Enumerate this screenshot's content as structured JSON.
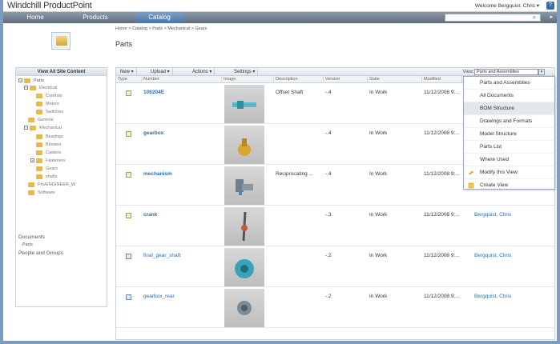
{
  "app": {
    "brand": "Windchill ProductPoint",
    "welcome": "Welcome Bergquist, Chris ▾",
    "help_icon": "?"
  },
  "nav": {
    "tabs": [
      {
        "label": "Home"
      },
      {
        "label": "Products"
      },
      {
        "label": "Catalog"
      }
    ],
    "search_placeholder": "",
    "search_icon": "⌕"
  },
  "breadcrumb": "Home > Catalog > Parts > Mechanical > Gears",
  "page_title": "Parts",
  "leftnav": {
    "header": "View All Site Content",
    "tree": [
      {
        "label": "Parts"
      },
      {
        "label": "Electrical"
      },
      {
        "label": "Controls"
      },
      {
        "label": "Motors"
      },
      {
        "label": "Switches"
      },
      {
        "label": "General"
      },
      {
        "label": "Mechanical"
      },
      {
        "label": "Bearings"
      },
      {
        "label": "Blowers"
      },
      {
        "label": "Casters"
      },
      {
        "label": "Fasteners"
      },
      {
        "label": "Gears"
      },
      {
        "label": "shafts"
      },
      {
        "label": "Pro/ENGINEER_W"
      },
      {
        "label": "Software"
      }
    ],
    "links": [
      "Documents",
      "Parts",
      "People and Groups"
    ]
  },
  "toolbar": {
    "new": "New ▾",
    "upload": "Upload ▾",
    "actions": "Actions ▾",
    "settings": "Settings ▾",
    "view_label": "View:",
    "view_value": "Parts and Assemblies",
    "view_btn": "▾"
  },
  "columns": [
    "Type",
    "Number",
    "Image",
    "Description",
    "Version",
    "State",
    "Modified"
  ],
  "rows": [
    {
      "number": "106204E",
      "description": "Offset Shaft",
      "version": "-.4",
      "state": "In Work",
      "modified": "11/12/2008 9:...",
      "modified_by": ""
    },
    {
      "number": "gearbox",
      "description": "",
      "version": "-.4",
      "state": "In Work",
      "modified": "11/12/2008 9:...",
      "modified_by": ""
    },
    {
      "number": "mechanism",
      "description": "Reciprocating ...",
      "version": "-.4",
      "state": "In Work",
      "modified": "11/12/2008 9:...",
      "modified_by": ""
    },
    {
      "number": "crank",
      "description": "",
      "version": "-.3",
      "state": "In Work",
      "modified": "11/12/2008 9:...",
      "modified_by": "Bergquist, Chris"
    },
    {
      "number": "final_gear_shaft",
      "description": "",
      "version": "-.2",
      "state": "In Work",
      "modified": "11/12/2008 9:...",
      "modified_by": "Bergquist, Chris"
    },
    {
      "number": "gearbox_rear",
      "description": "",
      "version": "-.2",
      "state": "In Work",
      "modified": "11/12/2008 9:...",
      "modified_by": "Bergquist, Chris"
    }
  ],
  "dropdown": [
    {
      "label": "Parts and Assemblies"
    },
    {
      "label": "All Documents"
    },
    {
      "label": "BOM Structure"
    },
    {
      "label": "Drawings and Formats"
    },
    {
      "label": "Model Structure"
    },
    {
      "label": "Parts List"
    },
    {
      "label": "Where Used"
    },
    {
      "label": "Modify this View"
    },
    {
      "label": "Create View"
    }
  ],
  "colors": {
    "accent": "#4d74a6",
    "link": "#2b6cb0"
  }
}
